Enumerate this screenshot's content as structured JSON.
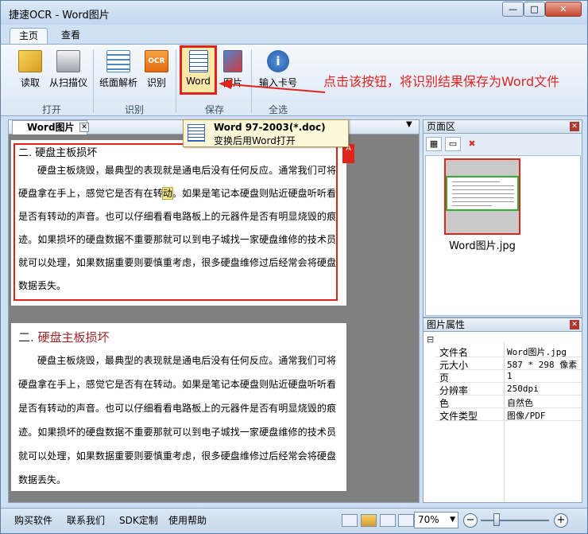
{
  "window": {
    "title": "捷速OCR - Word图片",
    "min_glyph": "—",
    "max_glyph": "□",
    "close_glyph": "✕"
  },
  "tabs": [
    {
      "label": "主页",
      "active": true
    },
    {
      "label": "查看",
      "active": false
    }
  ],
  "ribbon": {
    "buttons": [
      {
        "label": "读取",
        "icon": "folder-icon",
        "group": "打开"
      },
      {
        "label": "从扫描仪",
        "icon": "scanner-icon",
        "group": "打开"
      },
      {
        "label": "纸面解析",
        "icon": "layout-analysis-icon",
        "group": "识别"
      },
      {
        "label": "识别",
        "icon": "ocr-icon",
        "group": "识别"
      },
      {
        "label": "Word",
        "icon": "word-doc-icon",
        "group": "保存",
        "highlighted": true
      },
      {
        "label": "图片",
        "icon": "image-save-icon",
        "group": "保存"
      },
      {
        "label": "输入卡号",
        "icon": "info-icon",
        "group": "全选"
      }
    ],
    "groups": [
      "打开",
      "识别",
      "保存",
      "全选"
    ]
  },
  "annotation": "点击该按钮，将识别结果保存为Word文件",
  "tooltip": {
    "title": "Word 97-2003(*.doc)",
    "desc": "变换后用Word打开"
  },
  "document": {
    "tab_label": "Word图片",
    "tab_close": "✕",
    "menu_glyph": "▼",
    "mark_glyph": "A",
    "image_page": {
      "heading": "二. 硬盘主板损坏",
      "body_a": "硬盘主板烧毁，最典型的表现就是通电后没有任何反应。通常我们可将硬盘拿在手上，感觉它是否有在转",
      "body_hl": "动",
      "body_b": "。如果是笔记本硬盘则贴近硬盘听听看是否有转动的声音。也可以仔细看看电路板上的元器件是否有明显烧毁的痕迹。如果损坏的硬盘数据不重要那就可以到电子城找一家硬盘维修的技术员就可以处理，如果数据重要则要慎重考虑，很多硬盘维修过后经常会将硬盘数据丢失。"
    },
    "ocr_page": {
      "heading_num": "二. ",
      "heading_text": "硬盘主板损坏",
      "body": "硬盘主板烧毁，最典型的表现就是通电后没有任何反应。通常我们可将硬盘拿在手上，感觉它是否有在转动。如果是笔记本硬盘则贴近硬盘听听看是否有转动的声音。也可以仔细看看电路板上的元器件是否有明显烧毁的痕迹。如果损坏的硬盘数据不重要那就可以到电子城找一家硬盘维修的技术员就可以处理，如果数据重要则要慎重考虑，很多硬盘维修过后经常会将硬盘数据丢失。"
    }
  },
  "page_area": {
    "title": "页面区",
    "close_glyph": "✕",
    "thumb_name": "Word图片.jpg",
    "tool_delete_glyph": "✖"
  },
  "properties": {
    "title": "图片属性",
    "close_glyph": "✕",
    "toggle_glyph": "⊟",
    "rows": [
      {
        "key": "文件名",
        "value": "Word图片.jpg"
      },
      {
        "key": "元大小",
        "value": "587 * 298 像素"
      },
      {
        "key": "页",
        "value": "1"
      },
      {
        "key": "分辨率",
        "value": "250dpi"
      },
      {
        "key": "色",
        "value": "自然色"
      },
      {
        "key": "文件类型",
        "value": "图像/PDF"
      }
    ]
  },
  "status": {
    "links": [
      "购买软件",
      "联系我们",
      "SDK定制",
      "使用帮助"
    ],
    "zoom": "70%",
    "zoom_dropdown_glyph": "▼",
    "zoom_minus": "−",
    "zoom_plus": "+"
  }
}
